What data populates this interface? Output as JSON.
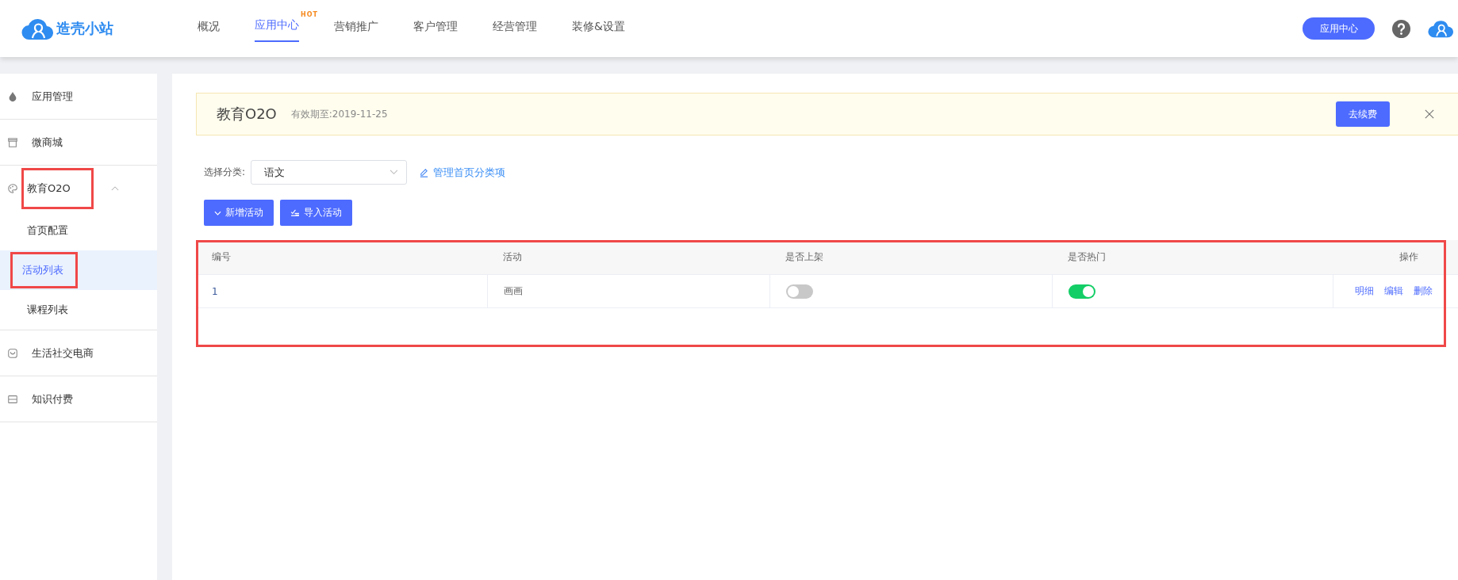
{
  "header": {
    "logo_text": "造壳小站",
    "nav": [
      {
        "label": "概况",
        "selected": false
      },
      {
        "label": "应用中心",
        "selected": true,
        "badge": "HOT"
      },
      {
        "label": "营销推广",
        "selected": false
      },
      {
        "label": "客户管理",
        "selected": false
      },
      {
        "label": "经营管理",
        "selected": false
      },
      {
        "label": "装修&设置",
        "selected": false
      }
    ],
    "app_button": "应用中心"
  },
  "sidebar": {
    "items": [
      {
        "label": "应用管理",
        "highlighted": false
      },
      {
        "label": "微商城",
        "highlighted": false
      },
      {
        "label": "教育O2O",
        "highlighted": true,
        "expanded": true,
        "children": [
          {
            "label": "首页配置",
            "selected": false,
            "highlighted": false
          },
          {
            "label": "活动列表",
            "selected": true,
            "highlighted": true
          },
          {
            "label": "课程列表",
            "selected": false,
            "highlighted": false
          }
        ]
      },
      {
        "label": "生活社交电商",
        "highlighted": false
      },
      {
        "label": "知识付费",
        "highlighted": false
      }
    ]
  },
  "banner": {
    "title": "教育O2O",
    "expiry": "有效期至:2019-11-25",
    "button": "去续费"
  },
  "filter": {
    "label": "选择分类:",
    "value": "语文",
    "link": "管理首页分类项"
  },
  "actions": [
    "新增活动",
    "导入活动"
  ],
  "table": {
    "highlighted": true,
    "columns": [
      "编号",
      "活动",
      "是否上架",
      "是否热门",
      "操作"
    ],
    "rows": [
      {
        "id": "1",
        "name": "画画",
        "listed": false,
        "hot": true,
        "links": [
          "明细",
          "编辑",
          "删除"
        ]
      }
    ]
  }
}
